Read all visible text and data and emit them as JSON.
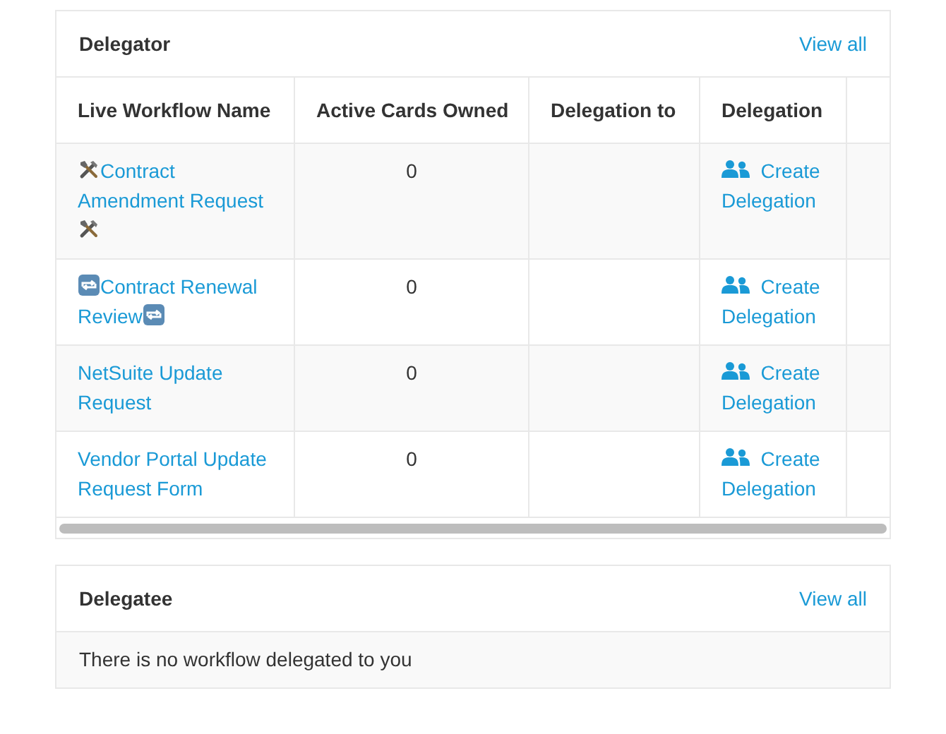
{
  "delegator": {
    "title": "Delegator",
    "view_all": "View all",
    "columns": [
      "Live Workflow Name",
      "Active Cards Owned",
      "Delegation to",
      "Delegation"
    ],
    "rows": [
      {
        "name": "Contract Amendment Request",
        "kind": "tools",
        "active_cards": "0",
        "action": "Create Delegation"
      },
      {
        "name": "Contract Renewal Review",
        "kind": "repeat",
        "active_cards": "0",
        "action": "Create Delegation"
      },
      {
        "name": "NetSuite Update Request",
        "active_cards": "0",
        "action": "Create Delegation"
      },
      {
        "name": "Vendor Portal Update Request Form",
        "active_cards": "0",
        "action": "Create Delegation"
      }
    ]
  },
  "delegatee": {
    "title": "Delegatee",
    "view_all": "View all",
    "empty_message": "There is no workflow delegated to you"
  }
}
